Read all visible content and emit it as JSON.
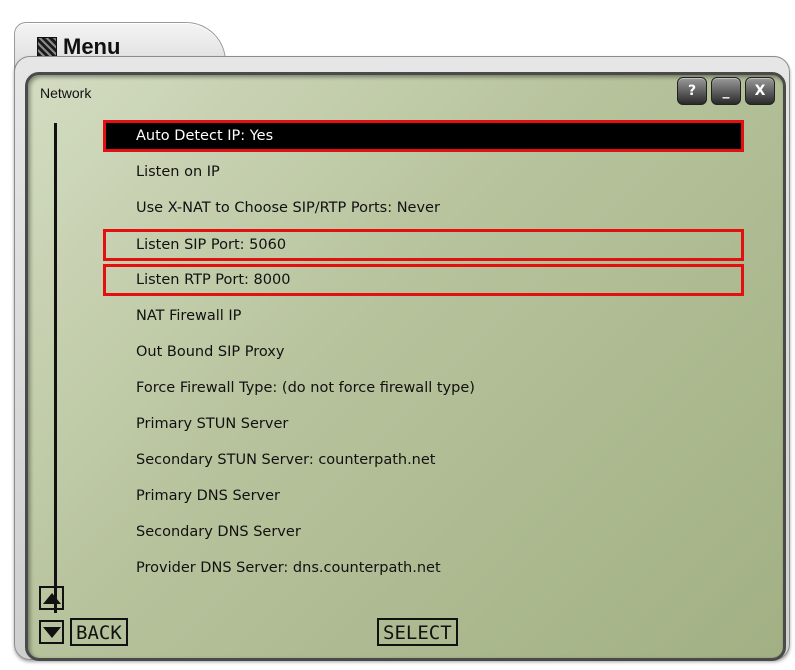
{
  "window": {
    "title": "Menu",
    "panel_title": "Network",
    "buttons": [
      "?",
      "_",
      "X"
    ]
  },
  "menu": {
    "items": [
      {
        "label": "Auto Detect IP: Yes",
        "state": "selected"
      },
      {
        "label": "Listen on IP",
        "state": "normal"
      },
      {
        "label": "Use X-NAT to Choose SIP/RTP Ports: Never",
        "state": "normal"
      },
      {
        "label": "Listen SIP Port: 5060",
        "state": "highlighted"
      },
      {
        "label": "Listen RTP Port: 8000",
        "state": "highlighted"
      },
      {
        "label": "NAT Firewall IP",
        "state": "normal"
      },
      {
        "label": "Out Bound SIP Proxy",
        "state": "normal"
      },
      {
        "label": "Force Firewall Type: (do not force firewall type)",
        "state": "normal"
      },
      {
        "label": "Primary STUN Server",
        "state": "normal"
      },
      {
        "label": "Secondary STUN Server: counterpath.net",
        "state": "normal"
      },
      {
        "label": "Primary DNS Server",
        "state": "normal"
      },
      {
        "label": "Secondary DNS Server",
        "state": "normal"
      },
      {
        "label": "Provider DNS Server: dns.counterpath.net",
        "state": "normal"
      }
    ]
  },
  "softkeys": {
    "back": "BACK",
    "select": "SELECT"
  },
  "colors": {
    "highlight_border": "#e31010",
    "selected_bg": "#000000",
    "lcd_bg": "#b6c29b"
  },
  "icons": {
    "title_icon": "menu-icon",
    "scroll_up": "arrow-up-icon",
    "scroll_down": "arrow-down-icon"
  }
}
